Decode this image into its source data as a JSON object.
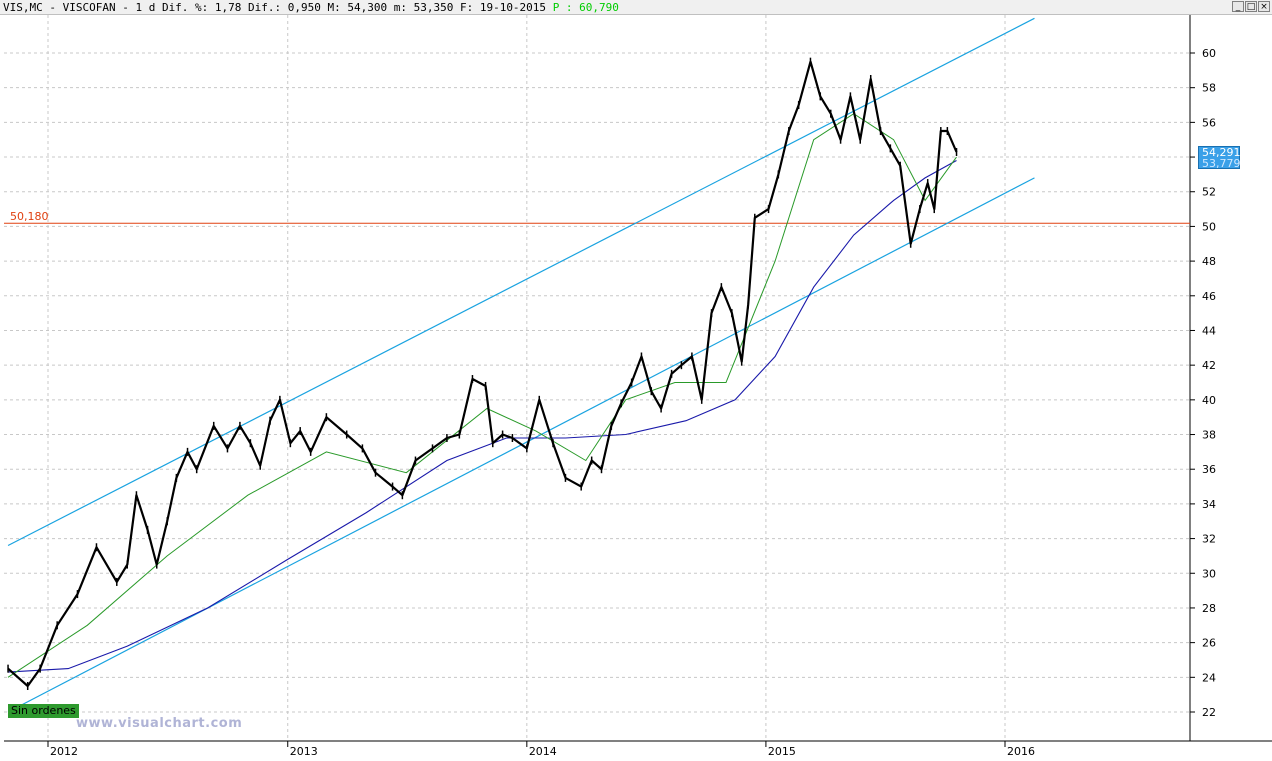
{
  "header": {
    "text": "VIS,MC - VISCOFAN -  1 d Dif. %: 1,78 Dif.: 0,950 M: 54,300 m: 53,350 F: 19-10-2015",
    "p_label": "P : 60,790"
  },
  "window_buttons": [
    "_",
    "□",
    "×"
  ],
  "watermark": "www.visualchart.com",
  "orders_badge": "Sin ordenes",
  "price_tag": {
    "value": "54,291",
    "value2": "53,779"
  },
  "colors": {
    "price": "#000000",
    "channel": "#1aa3e0",
    "ma_fast": "#2a9a2a",
    "ma_slow": "#1a1aaa",
    "support_line": "#e04010",
    "grid": "#c8c8c8"
  },
  "chart_data": {
    "type": "line",
    "title": "VIS,MC - VISCOFAN",
    "xlabel": "",
    "ylabel": "",
    "ylim": [
      20.5,
      62.5
    ],
    "x_ticks": [
      "2012",
      "2013",
      "2014",
      "2015",
      "2016"
    ],
    "y_ticks": [
      22,
      24,
      26,
      28,
      30,
      32,
      34,
      36,
      38,
      40,
      42,
      44,
      46,
      48,
      50,
      52,
      54,
      56,
      58,
      60
    ],
    "grid": true,
    "horizontal_line": {
      "value": 50.18,
      "label": "50,180"
    },
    "series": [
      {
        "name": "",
        "x": [
          "2011-11-01",
          "2011-12-01",
          "2011-12-20",
          "2012-01-15",
          "2012-02-15",
          "2012-03-15",
          "2012-04-15",
          "2012-05-01",
          "2012-05-15",
          "2012-06-01",
          "2012-06-15",
          "2012-07-01",
          "2012-07-15",
          "2012-08-01",
          "2012-08-15",
          "2012-09-10",
          "2012-10-01",
          "2012-10-20",
          "2012-11-05",
          "2012-11-20",
          "2012-12-05",
          "2012-12-20",
          "2013-01-05",
          "2013-01-20",
          "2013-02-05",
          "2013-03-01",
          "2013-04-01",
          "2013-04-25",
          "2013-05-15",
          "2013-06-10",
          "2013-06-25",
          "2013-07-15",
          "2013-08-10",
          "2013-09-01",
          "2013-09-20",
          "2013-10-10",
          "2013-10-30",
          "2013-11-10",
          "2013-11-25",
          "2013-12-10",
          "2014-01-01",
          "2014-01-20",
          "2014-02-10",
          "2014-03-01",
          "2014-03-25",
          "2014-04-10",
          "2014-04-25",
          "2014-05-10",
          "2014-05-25",
          "2014-06-10",
          "2014-06-25",
          "2014-07-10",
          "2014-07-25",
          "2014-08-10",
          "2014-08-25",
          "2014-09-10",
          "2014-09-25",
          "2014-10-10",
          "2014-10-25",
          "2014-11-10",
          "2014-11-25",
          "2014-12-05",
          "2014-12-15",
          "2015-01-05",
          "2015-01-20",
          "2015-02-05",
          "2015-02-20",
          "2015-03-10",
          "2015-03-25",
          "2015-04-10",
          "2015-04-25",
          "2015-05-10",
          "2015-05-25",
          "2015-06-10",
          "2015-06-25",
          "2015-07-10",
          "2015-07-25",
          "2015-08-10",
          "2015-08-24",
          "2015-09-05",
          "2015-09-15",
          "2015-09-25",
          "2015-10-05",
          "2015-10-19"
        ],
        "values": [
          24.5,
          23.5,
          24.5,
          27.0,
          28.8,
          31.5,
          29.5,
          30.5,
          34.5,
          32.5,
          30.5,
          33.0,
          35.5,
          37.0,
          36.0,
          38.5,
          37.2,
          38.5,
          37.5,
          36.2,
          38.8,
          40.0,
          37.5,
          38.2,
          37.0,
          39.0,
          38.0,
          37.2,
          35.8,
          35.0,
          34.5,
          36.5,
          37.2,
          37.8,
          38.0,
          41.2,
          40.8,
          37.5,
          38.0,
          37.8,
          37.2,
          40.0,
          37.5,
          35.5,
          35.0,
          36.5,
          36.0,
          38.5,
          39.8,
          41.0,
          42.5,
          40.5,
          39.5,
          41.5,
          42.0,
          42.5,
          40.0,
          45.0,
          46.5,
          45.0,
          42.2,
          45.5,
          50.5,
          51.0,
          53.0,
          55.5,
          57.0,
          59.5,
          57.5,
          56.5,
          55.0,
          57.5,
          55.0,
          58.5,
          55.5,
          54.5,
          53.5,
          49.0,
          51.0,
          52.5,
          51.0,
          55.5,
          55.5,
          54.29
        ]
      },
      {
        "name": "",
        "x": [
          "2011-11-01",
          "2012-03-01",
          "2012-07-01",
          "2012-11-01",
          "2013-03-01",
          "2013-07-01",
          "2013-11-01",
          "2014-01-15",
          "2014-04-01",
          "2014-06-01",
          "2014-08-15",
          "2014-11-01",
          "2015-01-15",
          "2015-03-15",
          "2015-05-15",
          "2015-07-15",
          "2015-09-01",
          "2015-10-19"
        ],
        "values": [
          24.0,
          27.0,
          31.0,
          34.5,
          37.0,
          35.8,
          39.5,
          38.2,
          36.5,
          40.0,
          41.0,
          41.0,
          48.0,
          55.0,
          56.5,
          55.0,
          51.5,
          54.0
        ]
      },
      {
        "name": "",
        "x": [
          "2011-11-01",
          "2012-02-01",
          "2012-05-01",
          "2012-09-01",
          "2013-01-01",
          "2013-05-01",
          "2013-09-01",
          "2013-12-01",
          "2014-03-01",
          "2014-06-01",
          "2014-09-01",
          "2014-11-15",
          "2015-01-15",
          "2015-03-15",
          "2015-05-15",
          "2015-07-15",
          "2015-09-01",
          "2015-10-19"
        ],
        "values": [
          24.3,
          24.5,
          25.8,
          28.0,
          30.8,
          33.5,
          36.5,
          37.8,
          37.8,
          38.0,
          38.8,
          40.0,
          42.5,
          46.5,
          49.5,
          51.5,
          52.8,
          53.8
        ]
      }
    ],
    "trendlines": [
      {
        "x": [
          "2011-11-01",
          "2016-02-15"
        ],
        "y": [
          31.6,
          62.0
        ]
      },
      {
        "x": [
          "2011-11-01",
          "2016-02-15"
        ],
        "y": [
          22.0,
          52.8
        ]
      }
    ]
  }
}
